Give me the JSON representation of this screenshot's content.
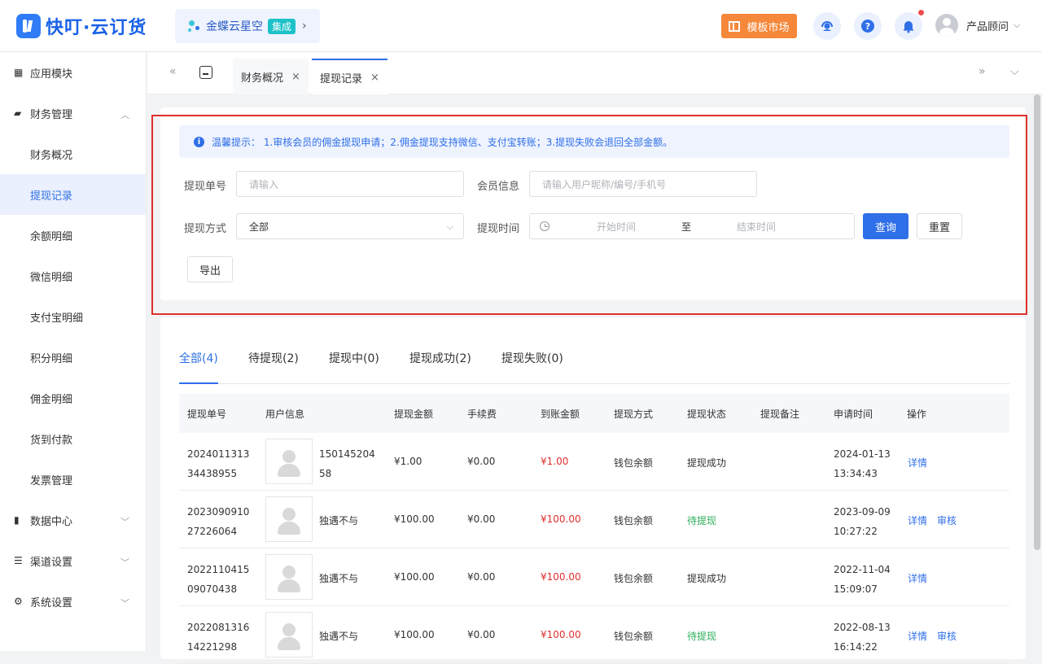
{
  "header": {
    "logo_text": "快叮·云订货",
    "integration_name": "金蝶云星空",
    "integration_badge": "集成",
    "integration_arrow": "›",
    "template_market": "模板市场",
    "user_name": "产品顾问",
    "user_caret": "⌵"
  },
  "sidebar": {
    "items": [
      {
        "label": "应用模块",
        "icon": "grid-icon",
        "glyph": "▦"
      },
      {
        "label": "财务管理",
        "icon": "wallet-icon",
        "glyph": "▰",
        "caret": "︿"
      },
      {
        "label": "财务概况"
      },
      {
        "label": "提现记录",
        "active": true
      },
      {
        "label": "余额明细"
      },
      {
        "label": "微信明细"
      },
      {
        "label": "支付宝明细"
      },
      {
        "label": "积分明细"
      },
      {
        "label": "佣金明细"
      },
      {
        "label": "货到付款"
      },
      {
        "label": "发票管理"
      },
      {
        "label": "数据中心",
        "icon": "bar-chart-icon",
        "glyph": "▮",
        "caret": "﹀"
      },
      {
        "label": "渠道设置",
        "icon": "list-icon",
        "glyph": "☰",
        "caret": "﹀"
      },
      {
        "label": "系统设置",
        "icon": "gear-icon",
        "glyph": "⚙",
        "caret": "﹀"
      }
    ]
  },
  "tabs": {
    "left_arrow": "«",
    "right_arrow": "»",
    "down_arrow": "⌵",
    "items": [
      {
        "label": "财务概况",
        "close": "×"
      },
      {
        "label": "提现记录",
        "close": "×"
      }
    ]
  },
  "filters": {
    "tip": "温馨提示： 1.审核会员的佣金提现申请；2.佣金提现支持微信、支付宝转账；3.提现失败会退回全部金额。",
    "order_no_label": "提现单号",
    "order_no_placeholder": "请输入",
    "member_label": "会员信息",
    "member_placeholder": "请输入用户昵称/编号/手机号",
    "method_label": "提现方式",
    "method_value": "全部",
    "time_label": "提现时间",
    "start_placeholder": "开始时间",
    "range_sep": "至",
    "end_placeholder": "结束时间",
    "query_btn": "查询",
    "reset_btn": "重置",
    "export_btn": "导出",
    "select_caret": "⌵"
  },
  "status_tabs": [
    {
      "label": "全部(4)",
      "active": true
    },
    {
      "label": "待提现(2)"
    },
    {
      "label": "提现中(0)"
    },
    {
      "label": "提现成功(2)"
    },
    {
      "label": "提现失败(0)"
    }
  ],
  "table": {
    "headers": [
      "提现单号",
      "用户信息",
      "提现金额",
      "手续费",
      "到账金额",
      "提现方式",
      "提现状态",
      "提现备注",
      "申请时间",
      "操作"
    ],
    "rows": [
      {
        "no": "202401131334438955",
        "user": "15014520458",
        "amount": "¥1.00",
        "fee": "¥0.00",
        "received": "¥1.00",
        "method": "钱包余额",
        "status": "提现成功",
        "status_type": "done",
        "time": "2024-01-13 13:34:43",
        "actions": [
          "详情"
        ]
      },
      {
        "no": "202309091027226064",
        "user": "独遇不与",
        "amount": "¥100.00",
        "fee": "¥0.00",
        "received": "¥100.00",
        "method": "钱包余额",
        "status": "待提现",
        "status_type": "pending",
        "time": "2023-09-09 10:27:22",
        "actions": [
          "详情",
          "审核"
        ]
      },
      {
        "no": "202211041509070438",
        "user": "独遇不与",
        "amount": "¥100.00",
        "fee": "¥0.00",
        "received": "¥100.00",
        "method": "钱包余额",
        "status": "提现成功",
        "status_type": "done",
        "time": "2022-11-04 15:09:07",
        "actions": [
          "详情"
        ]
      },
      {
        "no": "202208131614221298",
        "user": "独遇不与",
        "amount": "¥100.00",
        "fee": "¥0.00",
        "received": "¥100.00",
        "method": "钱包余额",
        "status": "待提现",
        "status_type": "pending",
        "time": "2022-08-13 16:14:22",
        "actions": [
          "详情",
          "审核"
        ]
      }
    ]
  },
  "colors": {
    "accent": "#2f6fe8",
    "highlight_border": "#e0302d",
    "amount_red": "#e02f2f",
    "pending_green": "#2fae5b",
    "template_orange": "#f5883a"
  }
}
